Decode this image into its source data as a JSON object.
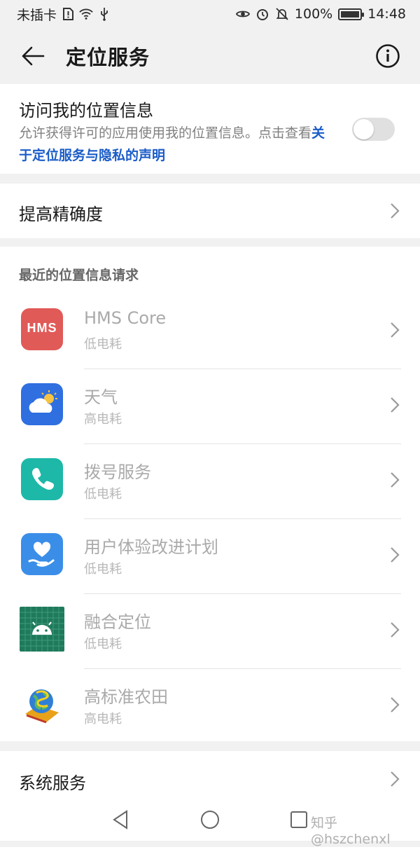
{
  "status_bar": {
    "carrier": "未插卡",
    "battery_percent": "100%",
    "battery_level": 1.0,
    "time": "14:48"
  },
  "header": {
    "title": "定位服务"
  },
  "location_access": {
    "title": "访问我的位置信息",
    "desc_prefix": "允许获得许可的应用使用我的位置信息。点击查看",
    "desc_link": "关于定位服务与隐私的声明",
    "toggle_on": false
  },
  "accuracy": {
    "label": "提高精确度"
  },
  "recent": {
    "section_label": "最近的位置信息请求",
    "apps": [
      {
        "name": "HMS Core",
        "power": "低电耗",
        "icon": "hms-core-icon"
      },
      {
        "name": "天气",
        "power": "高电耗",
        "icon": "weather-icon"
      },
      {
        "name": "拨号服务",
        "power": "低电耗",
        "icon": "dialer-icon"
      },
      {
        "name": "用户体验改进计划",
        "power": "低电耗",
        "icon": "user-experience-icon"
      },
      {
        "name": "融合定位",
        "power": "低电耗",
        "icon": "android-icon"
      },
      {
        "name": "高标准农田",
        "power": "高电耗",
        "icon": "farmland-globe-icon"
      }
    ],
    "hms_icon_text": "HMS"
  },
  "system": {
    "label": "系统服务"
  },
  "watermark": "知乎 @hszchenxl",
  "colors": {
    "link": "#1a5cc8",
    "background": "#f1f1f1",
    "card": "#ffffff"
  }
}
